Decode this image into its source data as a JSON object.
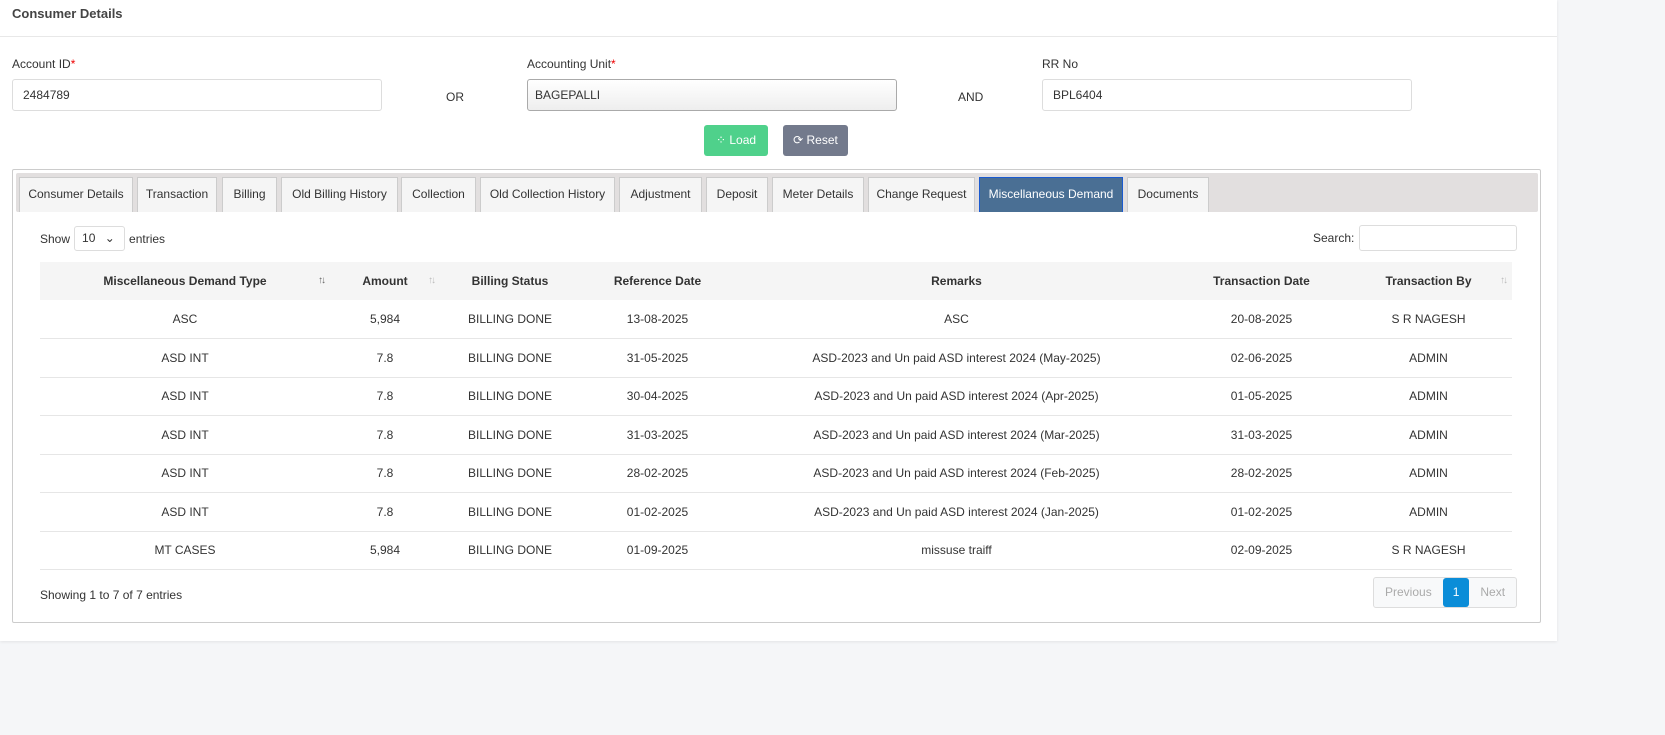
{
  "header": {
    "title": "Consumer Details"
  },
  "form": {
    "account_id_label": "Account ID",
    "account_id_value": "2484789",
    "or": "OR",
    "accounting_unit_label": "Accounting Unit",
    "accounting_unit_value": "BAGEPALLI",
    "and": "AND",
    "rr_no_label": "RR No",
    "rr_no_value": "BPL6404",
    "required_mark": "*",
    "load_label": "Load",
    "reset_label": "Reset"
  },
  "tabs": [
    "Consumer Details",
    "Transaction",
    "Billing",
    "Old Billing History",
    "Collection",
    "Old Collection History",
    "Adjustment",
    "Deposit",
    "Meter Details",
    "Change Request",
    "Miscellaneous Demand",
    "Documents"
  ],
  "active_tab": "Miscellaneous Demand",
  "table": {
    "show_label": "Show",
    "entries_label": "entries",
    "page_length": "10",
    "search_label": "Search:",
    "search_value": "",
    "columns": [
      "Miscellaneous Demand Type",
      "Amount",
      "Billing Status",
      "Reference Date",
      "Remarks",
      "Transaction Date",
      "Transaction By"
    ],
    "rows": [
      [
        "ASC",
        "5,984",
        "BILLING DONE",
        "13-08-2025",
        "ASC",
        "20-08-2025",
        "S R NAGESH"
      ],
      [
        "ASD INT",
        "7.8",
        "BILLING DONE",
        "31-05-2025",
        "ASD-2023 and Un paid ASD interest 2024 (May-2025)",
        "02-06-2025",
        "ADMIN"
      ],
      [
        "ASD INT",
        "7.8",
        "BILLING DONE",
        "30-04-2025",
        "ASD-2023 and Un paid ASD interest 2024 (Apr-2025)",
        "01-05-2025",
        "ADMIN"
      ],
      [
        "ASD INT",
        "7.8",
        "BILLING DONE",
        "31-03-2025",
        "ASD-2023 and Un paid ASD interest 2024 (Mar-2025)",
        "31-03-2025",
        "ADMIN"
      ],
      [
        "ASD INT",
        "7.8",
        "BILLING DONE",
        "28-02-2025",
        "ASD-2023 and Un paid ASD interest 2024 (Feb-2025)",
        "28-02-2025",
        "ADMIN"
      ],
      [
        "ASD INT",
        "7.8",
        "BILLING DONE",
        "01-02-2025",
        "ASD-2023 and Un paid ASD interest 2024 (Jan-2025)",
        "01-02-2025",
        "ADMIN"
      ],
      [
        "MT CASES",
        "5,984",
        "BILLING DONE",
        "01-09-2025",
        "missuse traiff",
        "02-09-2025",
        "S R NAGESH"
      ]
    ],
    "info": "Showing 1 to 7 of 7 entries",
    "pagination": {
      "previous": "Previous",
      "current": "1",
      "next": "Next"
    }
  }
}
